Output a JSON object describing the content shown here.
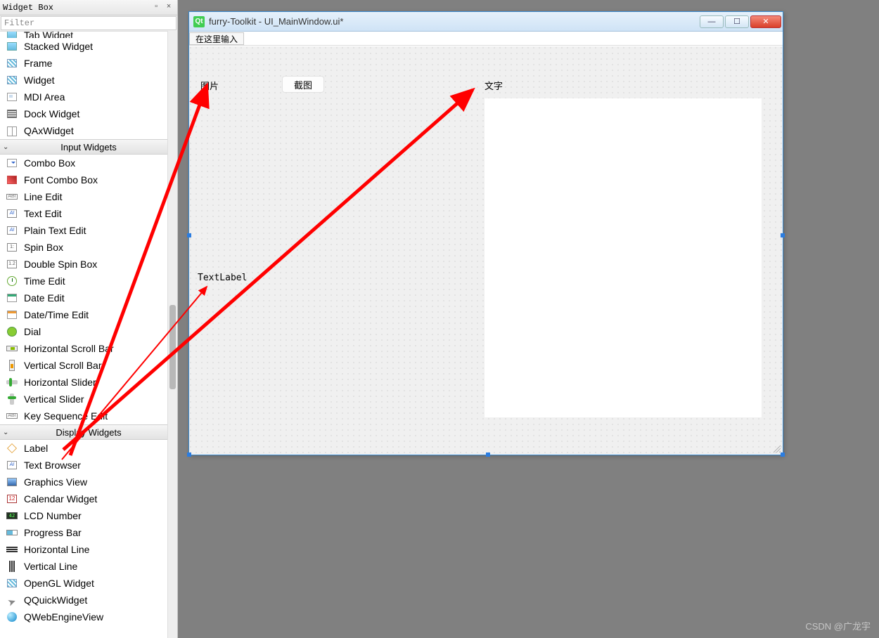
{
  "widgetbox": {
    "title": "Widget Box",
    "filter_placeholder": "Filter",
    "items_top": [
      {
        "id": "tab-widget",
        "label": "Tab Widget",
        "icon": "ic-box",
        "cut": true
      },
      {
        "id": "stacked-widget",
        "label": "Stacked Widget",
        "icon": "ic-box"
      },
      {
        "id": "frame",
        "label": "Frame",
        "icon": "ic-hatch"
      },
      {
        "id": "widget",
        "label": "Widget",
        "icon": "ic-hatch"
      },
      {
        "id": "mdi-area",
        "label": "MDI Area",
        "icon": "ic-mdi"
      },
      {
        "id": "dock-widget",
        "label": "Dock Widget",
        "icon": "ic-dock"
      },
      {
        "id": "qax-widget",
        "label": "QAxWidget",
        "icon": "ic-ax"
      }
    ],
    "group_input": "Input Widgets",
    "items_input": [
      {
        "id": "combo-box",
        "label": "Combo Box",
        "icon": "ic-combo"
      },
      {
        "id": "font-combo-box",
        "label": "Font Combo Box",
        "icon": "ic-fontcombo"
      },
      {
        "id": "line-edit",
        "label": "Line Edit",
        "icon": "ic-lineedit",
        "glyph": "ABI"
      },
      {
        "id": "text-edit",
        "label": "Text Edit",
        "icon": "ic-textedit",
        "glyph": "AI"
      },
      {
        "id": "plain-text-edit",
        "label": "Plain Text Edit",
        "icon": "ic-textedit",
        "glyph": "AI"
      },
      {
        "id": "spin-box",
        "label": "Spin Box",
        "icon": "ic-spin",
        "glyph": "1:"
      },
      {
        "id": "double-spin-box",
        "label": "Double Spin Box",
        "icon": "ic-spin",
        "glyph": "1.2"
      },
      {
        "id": "time-edit",
        "label": "Time Edit",
        "icon": "ic-time"
      },
      {
        "id": "date-edit",
        "label": "Date Edit",
        "icon": "ic-date"
      },
      {
        "id": "datetime-edit",
        "label": "Date/Time Edit",
        "icon": "ic-datetime"
      },
      {
        "id": "dial",
        "label": "Dial",
        "icon": "ic-dial"
      },
      {
        "id": "h-scroll",
        "label": "Horizontal Scroll Bar",
        "icon": "ic-hscroll"
      },
      {
        "id": "v-scroll",
        "label": "Vertical Scroll Bar",
        "icon": "ic-vscroll"
      },
      {
        "id": "h-slider",
        "label": "Horizontal Slider",
        "icon": "ic-hslider"
      },
      {
        "id": "v-slider",
        "label": "Vertical Slider",
        "icon": "ic-vslider"
      },
      {
        "id": "key-seq",
        "label": "Key Sequence Edit",
        "icon": "ic-lineedit",
        "glyph": "ABI"
      }
    ],
    "group_display": "Display Widgets",
    "items_display": [
      {
        "id": "label",
        "label": "Label",
        "icon": "ic-label"
      },
      {
        "id": "text-browser",
        "label": "Text Browser",
        "icon": "ic-textedit",
        "glyph": "AI"
      },
      {
        "id": "graphics-view",
        "label": "Graphics View",
        "icon": "ic-graphics"
      },
      {
        "id": "calendar",
        "label": "Calendar Widget",
        "icon": "ic-cal",
        "glyph": "12"
      },
      {
        "id": "lcd",
        "label": "LCD Number",
        "icon": "ic-lcd",
        "glyph": "42"
      },
      {
        "id": "progress",
        "label": "Progress Bar",
        "icon": "ic-prog"
      },
      {
        "id": "h-line",
        "label": "Horizontal Line",
        "icon": "ic-hline"
      },
      {
        "id": "v-line",
        "label": "Vertical Line",
        "icon": "ic-vline"
      },
      {
        "id": "opengl",
        "label": "OpenGL Widget",
        "icon": "ic-hatch"
      },
      {
        "id": "qquick",
        "label": "QQuickWidget",
        "icon": "ic-qquick"
      },
      {
        "id": "qweb",
        "label": "QWebEngineView",
        "icon": "ic-globe"
      }
    ]
  },
  "designer": {
    "title": "furry-Toolkit - UI_MainWindow.ui*",
    "menu_placeholder": "在这里输入",
    "label_image": "图片",
    "button_screenshot": "截图",
    "label_text": "文字",
    "text_label": "TextLabel"
  },
  "watermark": "CSDN @广龙宇"
}
